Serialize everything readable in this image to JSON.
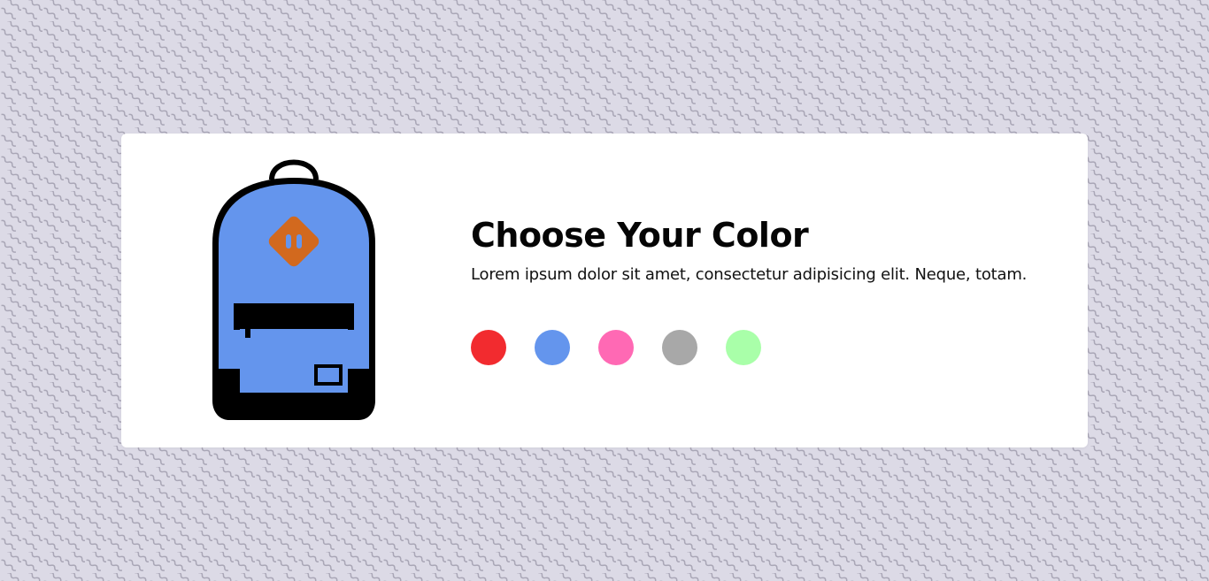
{
  "product": {
    "title": "Choose Your Color",
    "description": "Lorem ipsum dolor sit amet, consectetur adipisicing elit. Neque, totam.",
    "image_icon": "backpack-icon",
    "body_color": "#6495ed",
    "patch_color": "#d2691e"
  },
  "swatches": [
    {
      "name": "red",
      "color": "#f22b2f"
    },
    {
      "name": "blue",
      "color": "#6495ed"
    },
    {
      "name": "pink",
      "color": "#ff69b4"
    },
    {
      "name": "gray",
      "color": "#a8a8a8"
    },
    {
      "name": "green",
      "color": "#a9ffa9"
    }
  ]
}
